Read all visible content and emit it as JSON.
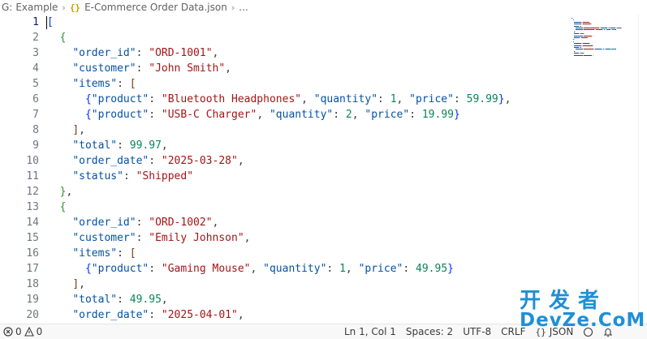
{
  "breadcrumb": {
    "drive": "G:",
    "folder": "Example",
    "file": "E-Commerce Order Data.json",
    "more": "..."
  },
  "editor": {
    "line_numbers": [
      "1",
      "2",
      "3",
      "4",
      "5",
      "6",
      "7",
      "8",
      "9",
      "10",
      "11",
      "12",
      "13",
      "14",
      "15",
      "16",
      "17",
      "18",
      "19",
      "20"
    ],
    "lines": [
      [
        {
          "t": "[",
          "c": "b1"
        }
      ],
      [
        {
          "t": "  ",
          "c": "p"
        },
        {
          "t": "{",
          "c": "b2"
        }
      ],
      [
        {
          "t": "    ",
          "c": "p"
        },
        {
          "t": "\"order_id\"",
          "c": "k"
        },
        {
          "t": ": ",
          "c": "p"
        },
        {
          "t": "\"ORD-1001\"",
          "c": "s"
        },
        {
          "t": ",",
          "c": "p"
        }
      ],
      [
        {
          "t": "    ",
          "c": "p"
        },
        {
          "t": "\"customer\"",
          "c": "k"
        },
        {
          "t": ": ",
          "c": "p"
        },
        {
          "t": "\"John Smith\"",
          "c": "s"
        },
        {
          "t": ",",
          "c": "p"
        }
      ],
      [
        {
          "t": "    ",
          "c": "p"
        },
        {
          "t": "\"items\"",
          "c": "k"
        },
        {
          "t": ": ",
          "c": "p"
        },
        {
          "t": "[",
          "c": "b3"
        }
      ],
      [
        {
          "t": "      ",
          "c": "p"
        },
        {
          "t": "{",
          "c": "b1"
        },
        {
          "t": "\"product\"",
          "c": "k"
        },
        {
          "t": ": ",
          "c": "p"
        },
        {
          "t": "\"Bluetooth Headphones\"",
          "c": "s"
        },
        {
          "t": ", ",
          "c": "p"
        },
        {
          "t": "\"quantity\"",
          "c": "k"
        },
        {
          "t": ": ",
          "c": "p"
        },
        {
          "t": "1",
          "c": "n"
        },
        {
          "t": ", ",
          "c": "p"
        },
        {
          "t": "\"price\"",
          "c": "k"
        },
        {
          "t": ": ",
          "c": "p"
        },
        {
          "t": "59.99",
          "c": "n"
        },
        {
          "t": "}",
          "c": "b1"
        },
        {
          "t": ",",
          "c": "p"
        }
      ],
      [
        {
          "t": "      ",
          "c": "p"
        },
        {
          "t": "{",
          "c": "b1"
        },
        {
          "t": "\"product\"",
          "c": "k"
        },
        {
          "t": ": ",
          "c": "p"
        },
        {
          "t": "\"USB-C Charger\"",
          "c": "s"
        },
        {
          "t": ", ",
          "c": "p"
        },
        {
          "t": "\"quantity\"",
          "c": "k"
        },
        {
          "t": ": ",
          "c": "p"
        },
        {
          "t": "2",
          "c": "n"
        },
        {
          "t": ", ",
          "c": "p"
        },
        {
          "t": "\"price\"",
          "c": "k"
        },
        {
          "t": ": ",
          "c": "p"
        },
        {
          "t": "19.99",
          "c": "n"
        },
        {
          "t": "}",
          "c": "b1"
        }
      ],
      [
        {
          "t": "    ",
          "c": "p"
        },
        {
          "t": "]",
          "c": "b3"
        },
        {
          "t": ",",
          "c": "p"
        }
      ],
      [
        {
          "t": "    ",
          "c": "p"
        },
        {
          "t": "\"total\"",
          "c": "k"
        },
        {
          "t": ": ",
          "c": "p"
        },
        {
          "t": "99.97",
          "c": "n"
        },
        {
          "t": ",",
          "c": "p"
        }
      ],
      [
        {
          "t": "    ",
          "c": "p"
        },
        {
          "t": "\"order_date\"",
          "c": "k"
        },
        {
          "t": ": ",
          "c": "p"
        },
        {
          "t": "\"2025-03-28\"",
          "c": "s"
        },
        {
          "t": ",",
          "c": "p"
        }
      ],
      [
        {
          "t": "    ",
          "c": "p"
        },
        {
          "t": "\"status\"",
          "c": "k"
        },
        {
          "t": ": ",
          "c": "p"
        },
        {
          "t": "\"Shipped\"",
          "c": "s"
        }
      ],
      [
        {
          "t": "  ",
          "c": "p"
        },
        {
          "t": "}",
          "c": "b2"
        },
        {
          "t": ",",
          "c": "p"
        }
      ],
      [
        {
          "t": "  ",
          "c": "p"
        },
        {
          "t": "{",
          "c": "b2"
        }
      ],
      [
        {
          "t": "    ",
          "c": "p"
        },
        {
          "t": "\"order_id\"",
          "c": "k"
        },
        {
          "t": ": ",
          "c": "p"
        },
        {
          "t": "\"ORD-1002\"",
          "c": "s"
        },
        {
          "t": ",",
          "c": "p"
        }
      ],
      [
        {
          "t": "    ",
          "c": "p"
        },
        {
          "t": "\"customer\"",
          "c": "k"
        },
        {
          "t": ": ",
          "c": "p"
        },
        {
          "t": "\"Emily Johnson\"",
          "c": "s"
        },
        {
          "t": ",",
          "c": "p"
        }
      ],
      [
        {
          "t": "    ",
          "c": "p"
        },
        {
          "t": "\"items\"",
          "c": "k"
        },
        {
          "t": ": ",
          "c": "p"
        },
        {
          "t": "[",
          "c": "b3"
        }
      ],
      [
        {
          "t": "      ",
          "c": "p"
        },
        {
          "t": "{",
          "c": "b1"
        },
        {
          "t": "\"product\"",
          "c": "k"
        },
        {
          "t": ": ",
          "c": "p"
        },
        {
          "t": "\"Gaming Mouse\"",
          "c": "s"
        },
        {
          "t": ", ",
          "c": "p"
        },
        {
          "t": "\"quantity\"",
          "c": "k"
        },
        {
          "t": ": ",
          "c": "p"
        },
        {
          "t": "1",
          "c": "n"
        },
        {
          "t": ", ",
          "c": "p"
        },
        {
          "t": "\"price\"",
          "c": "k"
        },
        {
          "t": ": ",
          "c": "p"
        },
        {
          "t": "49.95",
          "c": "n"
        },
        {
          "t": "}",
          "c": "b1"
        }
      ],
      [
        {
          "t": "    ",
          "c": "p"
        },
        {
          "t": "]",
          "c": "b3"
        },
        {
          "t": ",",
          "c": "p"
        }
      ],
      [
        {
          "t": "    ",
          "c": "p"
        },
        {
          "t": "\"total\"",
          "c": "k"
        },
        {
          "t": ": ",
          "c": "p"
        },
        {
          "t": "49.95",
          "c": "n"
        },
        {
          "t": ",",
          "c": "p"
        }
      ],
      [
        {
          "t": "    ",
          "c": "p"
        },
        {
          "t": "\"order_date\"",
          "c": "k"
        },
        {
          "t": ": ",
          "c": "p"
        },
        {
          "t": "\"2025-04-01\"",
          "c": "s"
        },
        {
          "t": ",",
          "c": "p"
        }
      ]
    ]
  },
  "statusbar": {
    "errors": "0",
    "warnings": "0",
    "position": "Ln 1, Col 1",
    "spaces": "Spaces: 2",
    "encoding": "UTF-8",
    "eol": "CRLF",
    "language": "JSON"
  },
  "watermark": {
    "cn": "开发者",
    "en": "DevZe.CoM"
  },
  "colors": {
    "key": "#0451a5",
    "string": "#a31515",
    "number": "#098658",
    "bracket_level1": "#0431fa",
    "bracket_level2": "#319331",
    "bracket_level3": "#7b3814",
    "watermark": "#1f8fd6"
  }
}
